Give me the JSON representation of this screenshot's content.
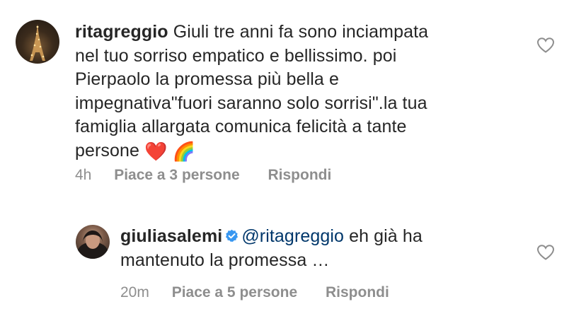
{
  "comments": [
    {
      "username": "ritagreggio",
      "text_lines": [
        " Giuli tre anni fa sono inciampata",
        "nel tuo sorriso empatico e bellissimo. poi",
        "Pierpaolo  la promessa più bella e",
        "impegnativa\"fuori saranno solo sorrisi\".la tua",
        "famiglia allargata comunica felicità a tante",
        "persone "
      ],
      "emojis": [
        "❤️",
        "🌈"
      ],
      "time": "4h",
      "likes": "Piace a 3 persone",
      "reply_label": "Rispondi",
      "avatar_icon": "eiffel-tower-night-avatar",
      "like_icon": "heart-outline-icon"
    },
    {
      "username": "giuliasalemi",
      "verified": true,
      "mention": "@ritagreggio",
      "text_line1_rest": " eh già ha",
      "text_line2": "mantenuto la promessa …",
      "time": "20m",
      "likes": "Piace a 5 persone",
      "reply_label": "Rispondi",
      "avatar_icon": "profile-photo-avatar",
      "verified_icon": "verified-badge-icon",
      "like_icon": "heart-outline-icon"
    }
  ],
  "colors": {
    "text": "#262626",
    "meta": "#8e8e8e",
    "mention": "#00376b",
    "verified": "#3897f0"
  }
}
